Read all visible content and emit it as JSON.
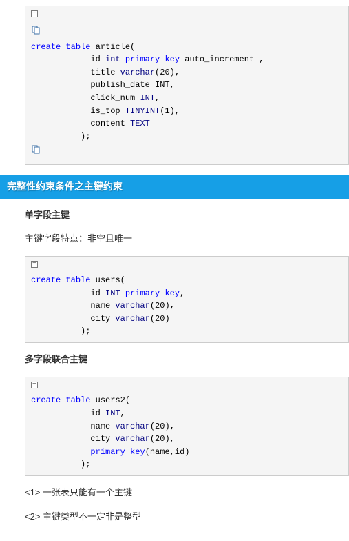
{
  "code1": {
    "line1_a": "create",
    "line1_b": "table",
    "line1_c": " article(",
    "line2_a": "            id ",
    "line2_b": "int",
    "line2_c": "primary",
    "line2_d": "key",
    "line2_e": " auto_increment ,",
    "line3_a": "            title ",
    "line3_b": "varchar",
    "line3_c": "(",
    "line3_d": "20",
    "line3_e": "),",
    "line4_a": "            publish_date INT,",
    "line5_a": "            click_num ",
    "line5_b": "INT",
    "line5_c": ",",
    "line6_a": "            is_top ",
    "line6_b": "TINYINT",
    "line6_c": "(",
    "line6_d": "1",
    "line6_e": "),",
    "line7_a": "            content ",
    "line7_b": "TEXT",
    "line8_a": "          );"
  },
  "section_header": "完整性约束条件之主键约束",
  "h_single": "单字段主键",
  "p_feature": "主键字段特点：非空且唯一",
  "code2": {
    "line1_a": "create",
    "line1_b": "table",
    "line1_c": " users(",
    "line2_a": "            id ",
    "line2_b": "INT",
    "line2_c": "primary",
    "line2_d": "key",
    "line2_e": ",",
    "line3_a": "            name ",
    "line3_b": "varchar",
    "line3_c": "(",
    "line3_d": "20",
    "line3_e": "),",
    "line4_a": "            city ",
    "line4_b": "varchar",
    "line4_c": "(",
    "line4_d": "20",
    "line4_e": ")",
    "line5_a": "          );"
  },
  "h_multi": "多字段联合主键",
  "code3": {
    "line1_a": "create",
    "line1_b": "table",
    "line1_c": " users2(",
    "line2_a": "            id ",
    "line2_b": "INT",
    "line2_c": ",",
    "line3_a": "            name ",
    "line3_b": "varchar",
    "line3_c": "(",
    "line3_d": "20",
    "line3_e": "),",
    "line4_a": "            city ",
    "line4_b": "varchar",
    "line4_c": "(",
    "line4_d": "20",
    "line4_e": "),",
    "line5_a": "            ",
    "line5_b": "primary",
    "line5_c": "key",
    "line5_d": "(name,id)",
    "line6_a": "          );"
  },
  "note1": "<1> 一张表只能有一个主键",
  "note2": "<2> 主键类型不一定非是整型"
}
